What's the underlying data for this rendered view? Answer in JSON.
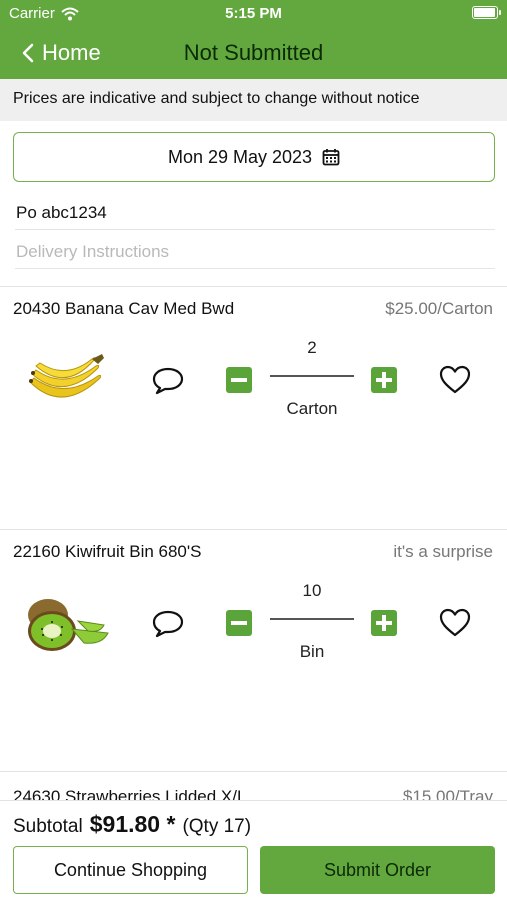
{
  "status_bar": {
    "carrier": "Carrier",
    "time": "5:15 PM",
    "battery_level": 1.0
  },
  "nav": {
    "back_label": "Home",
    "title": "Not Submitted"
  },
  "notice": "Prices are indicative and subject to change without notice",
  "order": {
    "date": "Mon 29 May 2023",
    "po_value": "Po abc1234",
    "delivery_placeholder": "Delivery Instructions"
  },
  "items": [
    {
      "name": "20430 Banana Cav Med Bwd",
      "price": "$25.00/Carton",
      "quantity": "2",
      "unit": "Carton",
      "image": "banana-image"
    },
    {
      "name": "22160 Kiwifruit Bin 680'S",
      "price": "it's a surprise",
      "quantity": "10",
      "unit": "Bin",
      "image": "kiwifruit-image"
    },
    {
      "name": "24630 Strawberries Lidded X/L",
      "price": "$15.00/Tray"
    }
  ],
  "footer": {
    "subtotal_label": "Subtotal",
    "subtotal_amount": "$91.80 *",
    "quantity_text": "(Qty 17)",
    "continue_label": "Continue Shopping",
    "submit_label": "Submit Order"
  },
  "colors": {
    "brand_green": "#63a83f",
    "button_green": "#5aa43a",
    "notice_bg": "#efefef"
  }
}
